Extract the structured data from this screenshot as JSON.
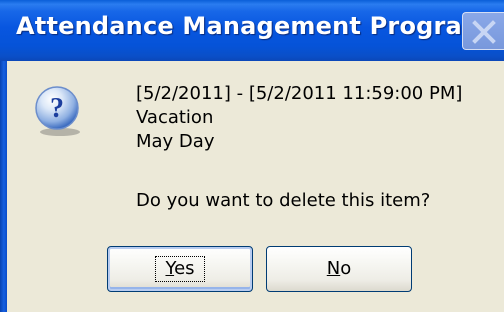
{
  "window": {
    "title": "Attendance Management Program",
    "close_icon": "close-icon",
    "accent_color": "#0553D8"
  },
  "message": {
    "icon": "question-icon",
    "date_range": "[5/2/2011] - [5/2/2011 11:59:00 PM]",
    "category": "Vacation",
    "description": "May Day",
    "prompt": "Do you want to delete this item?"
  },
  "buttons": {
    "yes": {
      "mnemonic": "Y",
      "rest": "es"
    },
    "no": {
      "mnemonic": "N",
      "rest": "o"
    }
  }
}
